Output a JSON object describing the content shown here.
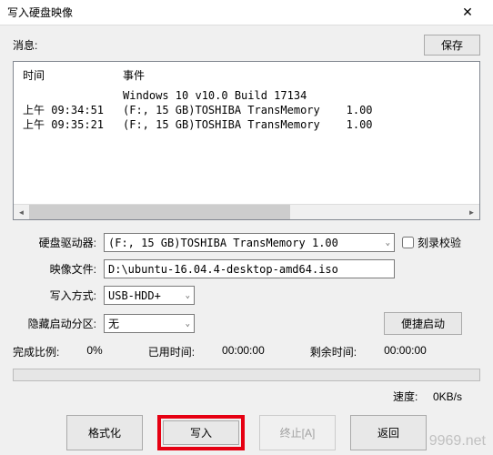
{
  "title": "写入硬盘映像",
  "msg_label": "消息:",
  "save_label": "保存",
  "event_header": {
    "time": "时间",
    "event": "事件"
  },
  "events": [
    {
      "time": "",
      "event": "Windows 10 v10.0 Build 17134"
    },
    {
      "time": "上午 09:34:51",
      "event": "(F:, 15 GB)TOSHIBA TransMemory    1.00"
    },
    {
      "time": "上午 09:35:21",
      "event": "(F:, 15 GB)TOSHIBA TransMemory    1.00"
    }
  ],
  "labels": {
    "drive": "硬盘驱动器:",
    "image": "映像文件:",
    "method": "写入方式:",
    "hidden": "隐藏启动分区:",
    "verify": "刻录校验",
    "quick": "便捷启动",
    "complete": "完成比例:",
    "elapsed": "已用时间:",
    "remain": "剩余时间:",
    "speed": "速度:"
  },
  "values": {
    "drive": "(F:, 15 GB)TOSHIBA TransMemory    1.00",
    "image": "D:\\ubuntu-16.04.4-desktop-amd64.iso",
    "method": "USB-HDD+",
    "hidden": "无",
    "complete": "0%",
    "elapsed": "00:00:00",
    "remain": "00:00:00",
    "speed": "0KB/s"
  },
  "buttons": {
    "format": "格式化",
    "write": "写入",
    "abort": "终止[A]",
    "back": "返回"
  },
  "watermark": "9969.net"
}
